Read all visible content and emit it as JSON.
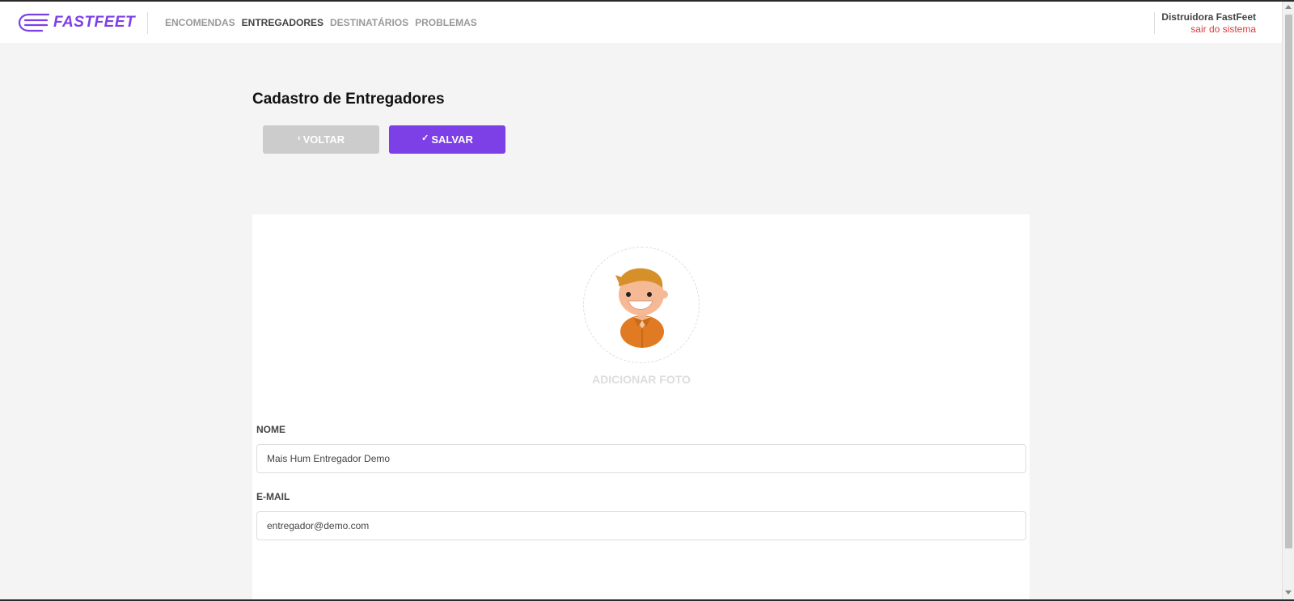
{
  "header": {
    "brand": "FASTFEET",
    "nav": [
      {
        "label": "ENCOMENDAS",
        "active": false
      },
      {
        "label": "ENTREGADORES",
        "active": true
      },
      {
        "label": "DESTINATÁRIOS",
        "active": false
      },
      {
        "label": "PROBLEMAS",
        "active": false
      }
    ],
    "user_name": "Distruidora FastFeet",
    "logout_label": "sair do sistema"
  },
  "page": {
    "title": "Cadastro de Entregadores",
    "back_label": "VOLTAR",
    "save_label": "SALVAR"
  },
  "form": {
    "avatar_label": "ADICIONAR FOTO",
    "name_label": "NOME",
    "name_value": "Mais Hum Entregador Demo",
    "email_label": "E-MAIL",
    "email_value": "entregador@demo.com"
  },
  "colors": {
    "brand": "#7d40e7",
    "logout": "#de3b3b",
    "back_button": "#cccccc"
  },
  "icons": {
    "logo": "fastfeet-logo-icon",
    "back": "chevron-left-icon",
    "save": "check-icon",
    "avatar": "avatar-illustration"
  }
}
